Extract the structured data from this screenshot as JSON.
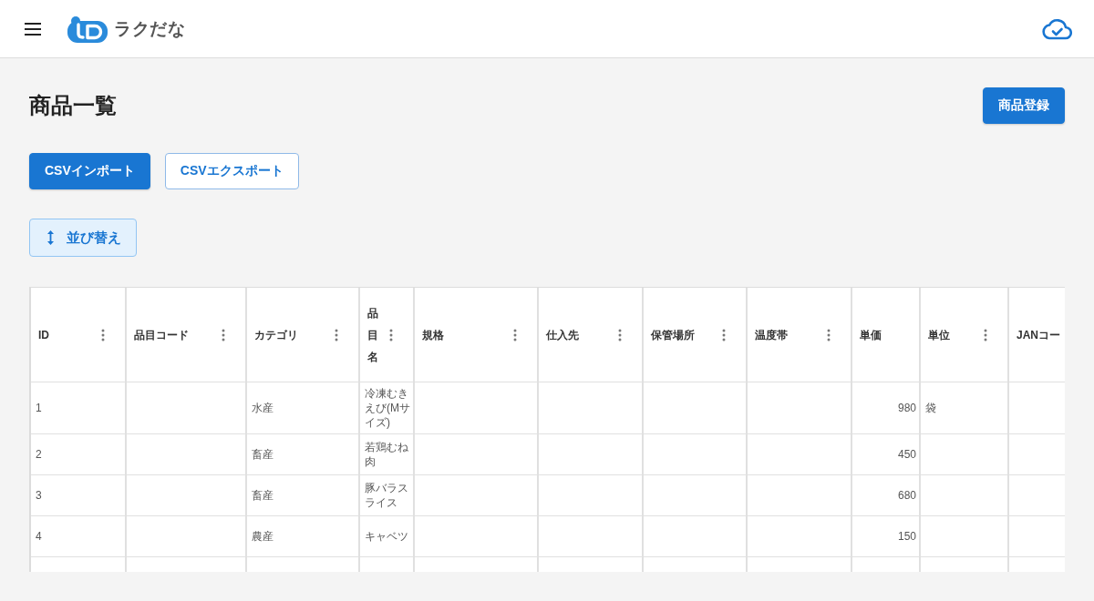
{
  "header": {
    "brand": "ラクだな"
  },
  "page": {
    "title": "商品一覧",
    "primary_action": "商品登録"
  },
  "toolbar": {
    "buttons": [
      {
        "label": "CSVインポート",
        "kind": "contained"
      },
      {
        "label": "CSVエクスポート",
        "kind": "outlined"
      }
    ]
  },
  "sort_button": {
    "label": "並び替え"
  },
  "table": {
    "columns": [
      {
        "label": "ID",
        "kind": "text",
        "menu": true,
        "values": [
          "1",
          "2",
          "3",
          "4"
        ]
      },
      {
        "label": "品目コード",
        "kind": "text",
        "menu": true
      },
      {
        "label": "カテゴリ",
        "kind": "text",
        "menu": true,
        "values": [
          "水産",
          "畜産",
          "畜産",
          "農産"
        ]
      },
      {
        "label": "品目名",
        "kind": "text",
        "menu": true,
        "values": [
          "冷凍むきえび(Mサイズ)",
          "若鶏むね肉",
          "豚バラスライス",
          "キャベツ"
        ]
      },
      {
        "label": "規格",
        "kind": "text",
        "menu": true
      },
      {
        "label": "仕入先",
        "kind": "text",
        "menu": true
      },
      {
        "label": "保管場所",
        "kind": "text",
        "menu": true
      },
      {
        "label": "温度帯",
        "kind": "text",
        "menu": true
      },
      {
        "label": "単価",
        "kind": "number",
        "menu": false,
        "values": [
          "980",
          "450",
          "680",
          "150"
        ]
      },
      {
        "label": "単位",
        "kind": "text",
        "menu": true,
        "values": [
          "袋"
        ]
      },
      {
        "label": "JANコー",
        "kind": "text",
        "menu": false
      }
    ]
  }
}
